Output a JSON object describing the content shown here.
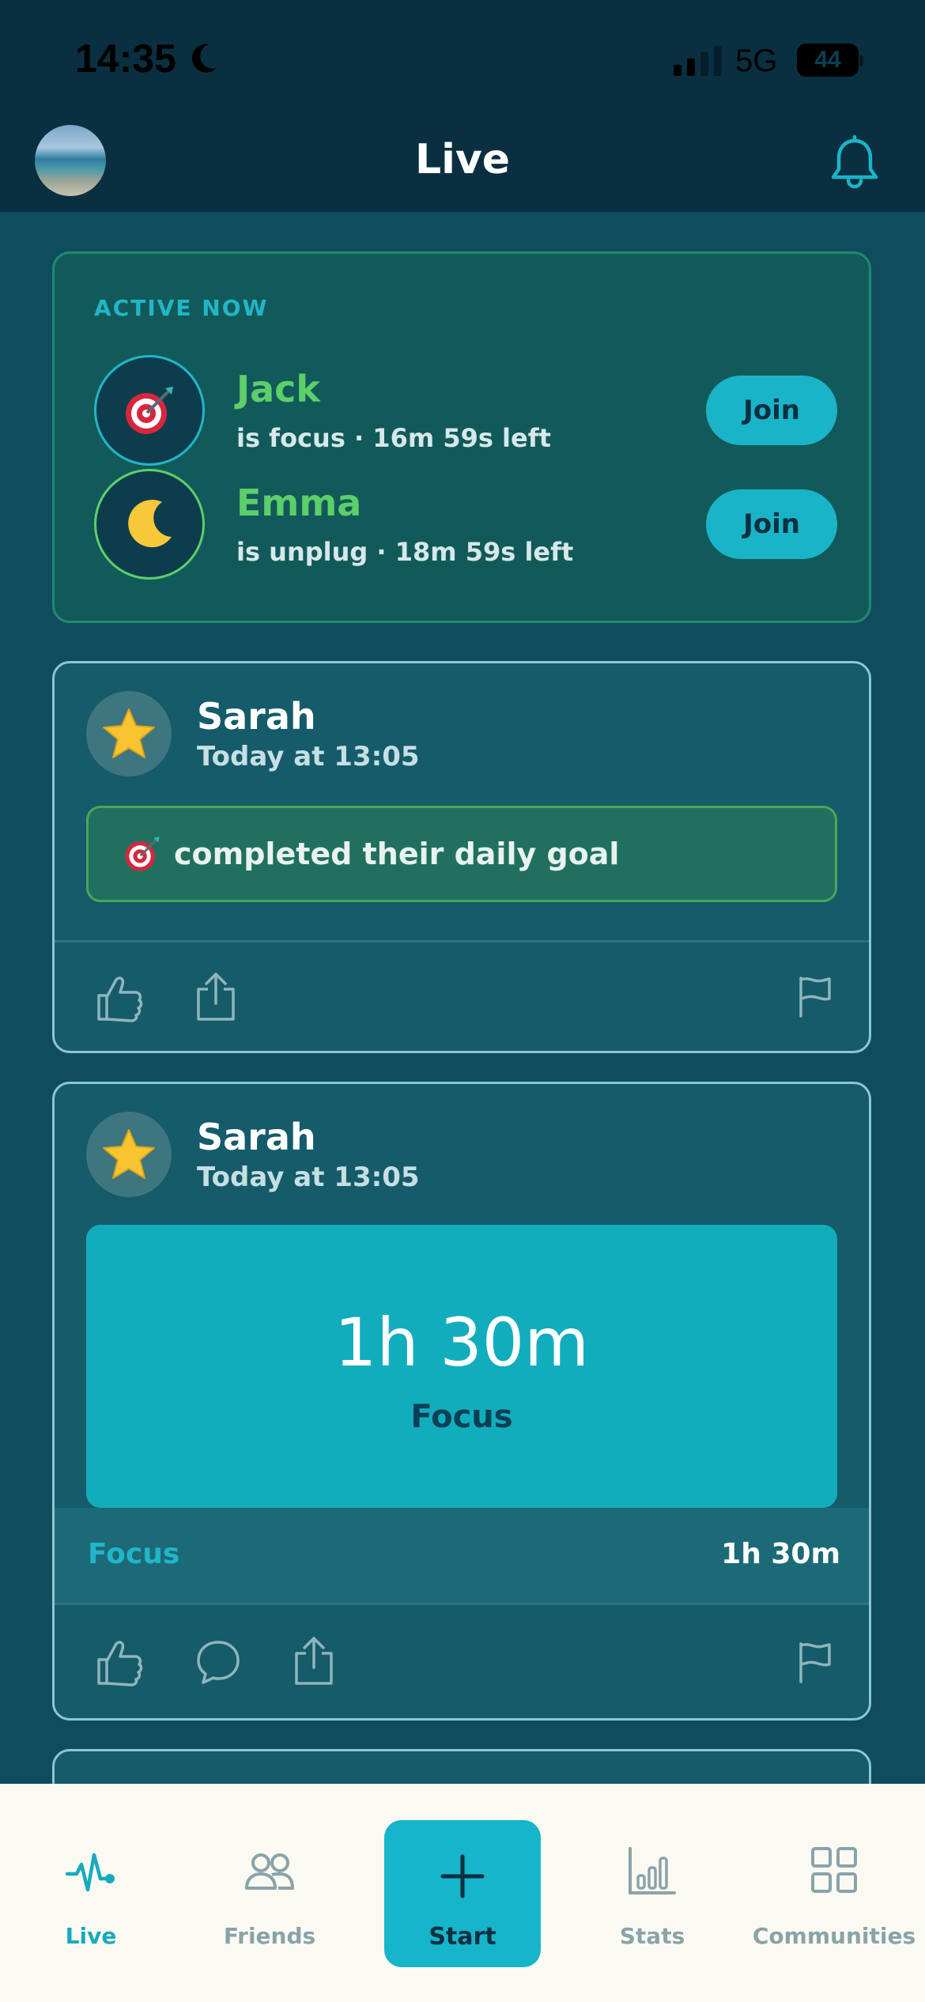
{
  "status_bar": {
    "time": "14:35",
    "network": "5G",
    "battery": "44"
  },
  "header": {
    "title": "Live"
  },
  "active_now": {
    "label": "ACTIVE NOW",
    "people": [
      {
        "name": "Jack",
        "status": "is focus · 16m 59s left",
        "icon": "dart-target-icon",
        "join_label": "Join"
      },
      {
        "name": "Emma",
        "status": "is unplug · 18m 59s left",
        "icon": "crescent-moon-icon",
        "join_label": "Join"
      }
    ]
  },
  "feed": [
    {
      "author": "Sarah",
      "time": "Today at 13:05",
      "avatar_icon": "star-icon",
      "type": "goal",
      "message": "completed their daily goal",
      "message_icon": "dart-target-icon",
      "actions": [
        "thumbs-up-icon",
        "share-icon",
        "flag-icon"
      ]
    },
    {
      "author": "Sarah",
      "time": "Today at 13:05",
      "avatar_icon": "star-icon",
      "type": "session",
      "duration": "1h 30m",
      "session_type": "Focus",
      "summary_label": "Focus",
      "summary_value": "1h 30m",
      "actions": [
        "thumbs-up-icon",
        "comment-icon",
        "share-icon",
        "flag-icon"
      ]
    }
  ],
  "tabbar": {
    "tabs": [
      {
        "label": "Live",
        "icon": "pulse-icon",
        "active": true
      },
      {
        "label": "Friends",
        "icon": "friends-icon",
        "active": false
      },
      {
        "label": "Start",
        "icon": "plus-icon",
        "active": false
      },
      {
        "label": "Stats",
        "icon": "bar-chart-icon",
        "active": false
      },
      {
        "label": "Communities",
        "icon": "grid-icon",
        "active": false
      }
    ]
  },
  "colors": {
    "background": "#0f4d5e",
    "header": "#0a2f40",
    "accent": "#17b5c9",
    "active_green": "#5ccf6a",
    "tabbar": "#fbfaf2"
  }
}
